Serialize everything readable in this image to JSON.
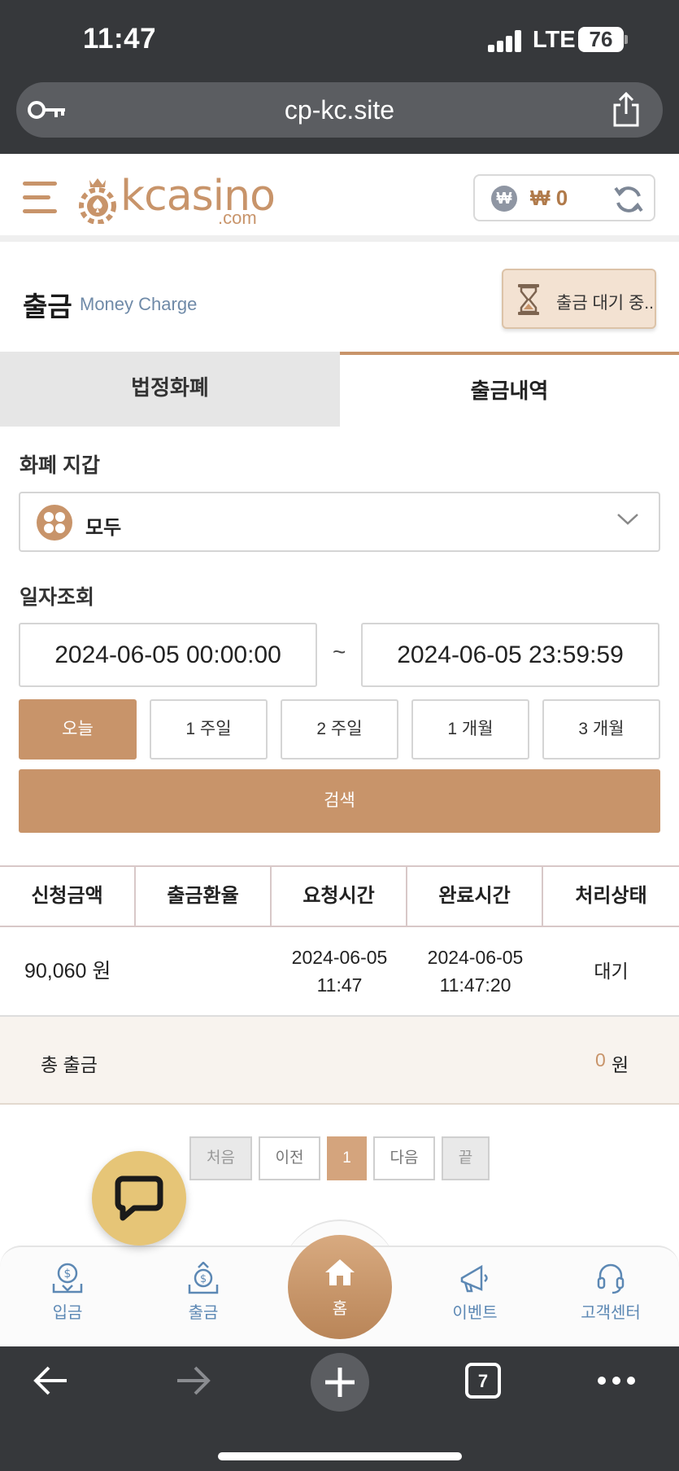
{
  "status_bar": {
    "time": "11:47",
    "network": "LTE",
    "battery": "76"
  },
  "browser": {
    "url": "cp-kc.site",
    "tab_count": "7"
  },
  "header": {
    "logo_text": "kcasino",
    "logo_suffix": ".com",
    "wallet_currency_icon": "₩",
    "wallet_amount": "₩ 0"
  },
  "page": {
    "title": "출금",
    "subtitle": "Money Charge",
    "pending_button": "출금 대기 중.."
  },
  "tabs": [
    {
      "label": "법정화폐",
      "active": false
    },
    {
      "label": "출금내역",
      "active": true
    }
  ],
  "filters": {
    "wallet_label": "화폐 지갑",
    "wallet_value": "모두",
    "date_label": "일자조회",
    "date_from": "2024-06-05 00:00:00",
    "date_separator": "~",
    "date_to": "2024-06-05 23:59:59",
    "ranges": [
      "오늘",
      "1 주일",
      "2 주일",
      "1 개월",
      "3 개월"
    ],
    "active_range": "오늘",
    "search_label": "검색"
  },
  "table": {
    "columns": [
      "신청금액",
      "출금환율",
      "요청시간",
      "완료시간",
      "처리상태"
    ],
    "rows": [
      {
        "amount": "90,060 원",
        "rate": "",
        "request_date": "2024-06-05",
        "request_time": "11:47",
        "complete_date": "2024-06-05",
        "complete_time": "11:47:20",
        "status": "대기"
      }
    ],
    "total_label": "총 출금",
    "total_value": "0",
    "total_unit": "원"
  },
  "pagination": {
    "first": "처음",
    "prev": "이전",
    "current": "1",
    "next": "다음",
    "last": "끝"
  },
  "bottom_nav": {
    "deposit": "입금",
    "withdraw": "출금",
    "home": "홈",
    "event": "이벤트",
    "support": "고객센터"
  },
  "colors": {
    "accent": "#c8946a",
    "nav_text": "#5c88b4",
    "chat_fab": "#e6c577",
    "dark_chrome": "#36383b"
  }
}
